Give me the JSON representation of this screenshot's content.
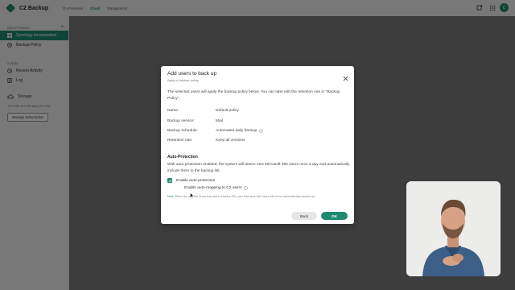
{
  "app": {
    "title": "C2 Backup",
    "nav_tabs": [
      "On-Premises",
      "Cloud",
      "Management"
    ],
    "active_tab": "Cloud",
    "avatar_initial": "C",
    "accent": "#1f8a70"
  },
  "sidebar": {
    "section_data_protection": "Data Protection",
    "items_protection": [
      {
        "label": "Synology Incorporated",
        "icon": "microsoft-icon",
        "active": true
      },
      {
        "label": "Backup Policy",
        "icon": "policy-icon",
        "active": false
      }
    ],
    "section_activity": "Activity",
    "items_activity": [
      {
        "label": "Recent Activity",
        "icon": "clock-icon"
      },
      {
        "label": "Log",
        "icon": "log-icon"
      }
    ],
    "storage_label": "Storage",
    "storage_usage": "12.5 GB of 5 TB used (0.27%)",
    "manage_button": "Manage Subscription"
  },
  "modal": {
    "title": "Add users to back up",
    "subtitle": "Apply a backup policy",
    "description": "The selected users will apply the backup policy below. You can later edit the retention rule in \"Backup Policy\".",
    "fields": [
      {
        "key": "Name:",
        "value": "Default policy",
        "info": false
      },
      {
        "key": "Backup service:",
        "value": "Mail",
        "info": false
      },
      {
        "key": "Backup schedule:",
        "value": "Automated daily backup",
        "info": true
      },
      {
        "key": "Retention rule:",
        "value": "Keep all versions",
        "info": false
      }
    ],
    "auto_protection_title": "Auto-Protection",
    "auto_protection_desc": "With auto-protection enabled, the system will detect new Microsoft 365 users once a day and automatically include them to the backup list.",
    "enable_auto_protection": {
      "label": "Enable auto-protection",
      "checked": true
    },
    "enable_auto_mapping": {
      "label": "Enable auto-mapping to C2 users",
      "checked": false
    },
    "note_label": "Note:",
    "note_text": "When the number of backup users reaches 250, new Microsoft 365 users will not be automatically backed up.",
    "back_button": "Back",
    "ok_button": "OK"
  }
}
